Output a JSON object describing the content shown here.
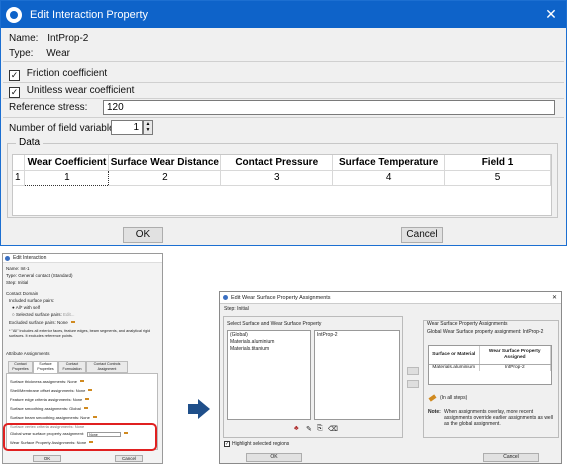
{
  "edit_interaction_property": {
    "title": "Edit Interaction Property",
    "close_glyph": "✕",
    "name_label": "Name:",
    "name_value": "IntProp-2",
    "type_label": "Type:",
    "type_value": "Wear",
    "friction_label": "Friction coefficient",
    "friction_checked": true,
    "unitless_label": "Unitless wear coefficient",
    "unitless_checked": true,
    "reference_stress_label": "Reference stress:",
    "reference_stress_value": "120",
    "field_vars_label": "Number of field variables:",
    "field_vars_value": "1",
    "data_legend": "Data",
    "table": {
      "columns": [
        "Wear Coefficient",
        "Surface Wear Distance",
        "Contact Pressure",
        "Surface Temperature",
        "Field 1"
      ],
      "rows": [
        {
          "index": "1",
          "cells": [
            "1",
            "2",
            "3",
            "4",
            "5"
          ]
        }
      ]
    },
    "ok_label": "OK",
    "cancel_label": "Cancel"
  },
  "edit_interaction": {
    "title": "Edit Interaction",
    "name_line": "Name:   Int-1",
    "type_line": "Type:   General contact (Standard)",
    "step_line": "Step:   Initial",
    "contact_domain": "Contact Domain",
    "included_pairs": "Included surface pairs:",
    "all_self": "All* with self",
    "selected_pairs": "Selected surface pairs:",
    "edit_link": "Edit...",
    "excluded_pairs": "Excluded surface pairs:  None",
    "note": "* \"All\" includes all exterior faces, feature edges, beam segments, and analytical rigid surfaces. It excludes reference points.",
    "attribute_assignments": "Attribute Assignments",
    "tabs": [
      "Contact Properties",
      "Surface Properties",
      "Contact Formulation",
      "Contact Controls Assignment"
    ],
    "rows": [
      "Surface thickness assignments:   None",
      "Shell/Membrane offset assignments:   None",
      "Feature edge criteria assignments:   None",
      "Surface smoothing assignments:   Global",
      "Surface beam smoothing assignments:   None",
      "Surface vertex criteria assignments:   None"
    ],
    "global_wear_label": "Global wear surface property assignment:",
    "global_wear_value": "None",
    "wear_surface_label": "Wear Surface Property Assignments:   None",
    "ok_label": "OK",
    "cancel_label": "Cancel"
  },
  "edit_wear": {
    "title": "Edit Wear Surface Property Assignments",
    "close_glyph": "✕",
    "step_line": "Step:   Initial",
    "left_title": "Select Surface and Wear Surface Property",
    "surfaces": [
      "(Global)",
      "Materials.aluminium",
      "Materials.titanium"
    ],
    "properties": [
      "IntProp-2"
    ],
    "highlight_label": "Highlight selected regions",
    "right_title": "Wear Surface Property Assignments",
    "global_line": "Global Wear Surface property assignment:   IntProp-2",
    "table_headers": [
      "Surface or Material",
      "Wear Surface Property Assigned"
    ],
    "table_rows": [
      [
        "Materials.aluminium",
        "IntProp-2"
      ]
    ],
    "in_all_steps": "(In all steps)",
    "note_label": "Note:",
    "note_text": "When assignments overlay, more recent assignments override earlier assignments as well as the global assignment.",
    "ok_label": "OK",
    "cancel_label": "Cancel"
  }
}
